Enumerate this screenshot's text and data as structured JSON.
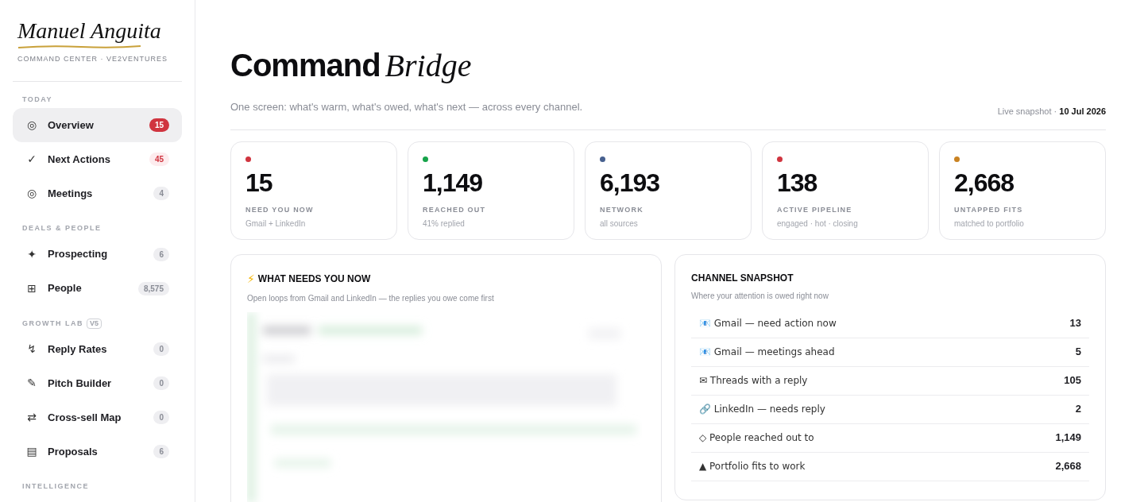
{
  "brand": {
    "name": "Manuel Anguita",
    "tagline": "COMMAND CENTER · VE2VENTURES"
  },
  "sidebar": {
    "sections": [
      {
        "title": "TODAY",
        "items": [
          {
            "icon": "◎",
            "label": "Overview",
            "count": "15",
            "kind": "alert",
            "selected": true
          },
          {
            "icon": "✓",
            "label": "Next Actions",
            "count": "45",
            "kind": "warn",
            "selected": false
          },
          {
            "icon": "◎",
            "label": "Meetings",
            "count": "4",
            "kind": "neutral",
            "selected": false
          }
        ]
      },
      {
        "title": "DEALS & PEOPLE",
        "items": [
          {
            "icon": "✦",
            "label": "Prospecting",
            "count": "6",
            "kind": "neutral",
            "selected": false
          },
          {
            "icon": "⊞",
            "label": "People",
            "count": "8,575",
            "kind": "neutral",
            "selected": false
          }
        ]
      },
      {
        "title": "GROWTH LAB",
        "tag": "V5",
        "items": [
          {
            "icon": "↯",
            "label": "Reply Rates",
            "count": "0",
            "kind": "neutral",
            "selected": false
          },
          {
            "icon": "✎",
            "label": "Pitch Builder",
            "count": "0",
            "kind": "neutral",
            "selected": false
          },
          {
            "icon": "⇄",
            "label": "Cross-sell Map",
            "count": "0",
            "kind": "neutral",
            "selected": false
          },
          {
            "icon": "▤",
            "label": "Proposals",
            "count": "6",
            "kind": "neutral",
            "selected": false
          }
        ]
      },
      {
        "title": "INTELLIGENCE"
      }
    ]
  },
  "header": {
    "title": "Command",
    "title_accent": "Bridge",
    "subtitle": "One screen: what's warm, what's owed, what's next — across every channel.",
    "snapshot_label": "Live snapshot · ",
    "snapshot_date": "10 Jul 2026"
  },
  "stats": [
    {
      "color": "#d0343f",
      "value": "15",
      "label": "NEED YOU NOW",
      "note": "Gmail + LinkedIn"
    },
    {
      "color": "#16a34a",
      "value": "1,149",
      "label": "REACHED OUT",
      "note": "41% replied"
    },
    {
      "color": "#47608f",
      "value": "6,193",
      "label": "NETWORK",
      "note": "all sources"
    },
    {
      "color": "#d0343f",
      "value": "138",
      "label": "ACTIVE PIPELINE",
      "note": "engaged · hot · closing"
    },
    {
      "color": "#c98222",
      "value": "2,668",
      "label": "UNTAPPED FITS",
      "note": "matched to portfolio"
    }
  ],
  "needs_panel": {
    "icon": "⚡",
    "title": "WHAT NEEDS YOU NOW",
    "subtitle": "Open loops from Gmail and LinkedIn — the replies you owe come first"
  },
  "channel_panel": {
    "title": "CHANNEL SNAPSHOT",
    "subtitle": "Where your attention is owed right now",
    "rows": [
      {
        "label": "📧 Gmail — need action now",
        "value": "13"
      },
      {
        "label": "📧 Gmail — meetings ahead",
        "value": "5"
      },
      {
        "label": "✉ Threads with a reply",
        "value": "105"
      },
      {
        "label": "🔗 LinkedIn — needs reply",
        "value": "2"
      },
      {
        "label": "◇ People reached out to",
        "value": "1,149"
      },
      {
        "label": "▲ Portfolio fits to work",
        "value": "2,668"
      }
    ]
  }
}
